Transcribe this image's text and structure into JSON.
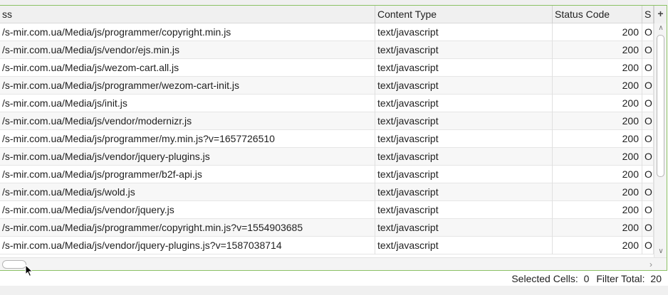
{
  "table": {
    "columns": [
      {
        "key": "address",
        "label": "ss"
      },
      {
        "key": "content_type",
        "label": "Content Type"
      },
      {
        "key": "status_code",
        "label": "Status Code"
      },
      {
        "key": "s",
        "label": "S"
      }
    ],
    "add_column_icon": "plus-icon",
    "rows": [
      {
        "address": "/s-mir.com.ua/Media/js/programmer/copyright.min.js",
        "content_type": "text/javascript",
        "status_code": "200",
        "s": "O"
      },
      {
        "address": "/s-mir.com.ua/Media/js/vendor/ejs.min.js",
        "content_type": "text/javascript",
        "status_code": "200",
        "s": "O"
      },
      {
        "address": "/s-mir.com.ua/Media/js/wezom-cart.all.js",
        "content_type": "text/javascript",
        "status_code": "200",
        "s": "O"
      },
      {
        "address": "/s-mir.com.ua/Media/js/programmer/wezom-cart-init.js",
        "content_type": "text/javascript",
        "status_code": "200",
        "s": "O"
      },
      {
        "address": "/s-mir.com.ua/Media/js/init.js",
        "content_type": "text/javascript",
        "status_code": "200",
        "s": "O"
      },
      {
        "address": "/s-mir.com.ua/Media/js/vendor/modernizr.js",
        "content_type": "text/javascript",
        "status_code": "200",
        "s": "O"
      },
      {
        "address": "/s-mir.com.ua/Media/js/programmer/my.min.js?v=1657726510",
        "content_type": "text/javascript",
        "status_code": "200",
        "s": "O"
      },
      {
        "address": "/s-mir.com.ua/Media/js/vendor/jquery-plugins.js",
        "content_type": "text/javascript",
        "status_code": "200",
        "s": "O"
      },
      {
        "address": "/s-mir.com.ua/Media/js/programmer/b2f-api.js",
        "content_type": "text/javascript",
        "status_code": "200",
        "s": "O"
      },
      {
        "address": "/s-mir.com.ua/Media/js/wold.js",
        "content_type": "text/javascript",
        "status_code": "200",
        "s": "O"
      },
      {
        "address": "/s-mir.com.ua/Media/js/vendor/jquery.js",
        "content_type": "text/javascript",
        "status_code": "200",
        "s": "O"
      },
      {
        "address": "/s-mir.com.ua/Media/js/programmer/copyright.min.js?v=1554903685",
        "content_type": "text/javascript",
        "status_code": "200",
        "s": "O"
      },
      {
        "address": "/s-mir.com.ua/Media/js/vendor/jquery-plugins.js?v=1587038714",
        "content_type": "text/javascript",
        "status_code": "200",
        "s": "O"
      }
    ]
  },
  "scrollbars": {
    "up_icon": "chevron-up-icon",
    "down_icon": "chevron-down-icon",
    "right_icon": "chevron-right-icon"
  },
  "status_bar": {
    "selected_cells_label": "Selected Cells:",
    "selected_cells_value": "0",
    "filter_total_label": "Filter Total:",
    "filter_total_value": "20"
  },
  "colors": {
    "frame_border": "#8cc265",
    "header_bg": "#f0f0f0"
  }
}
